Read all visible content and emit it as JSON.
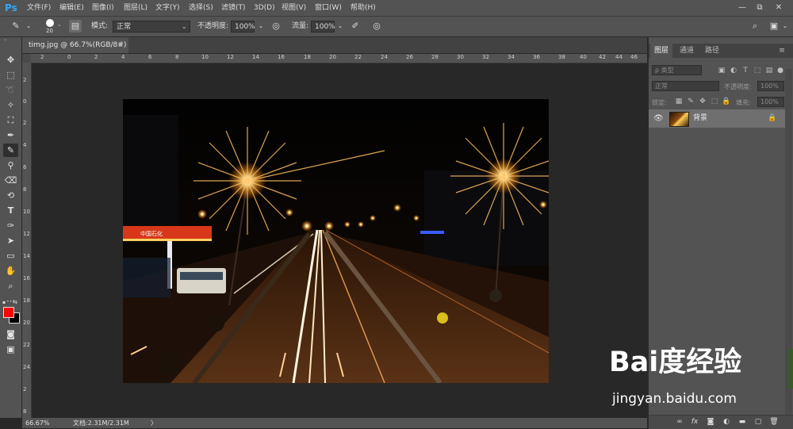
{
  "app": {
    "logo": "Ps"
  },
  "menu": [
    "文件(F)",
    "编辑(E)",
    "图像(I)",
    "图层(L)",
    "文字(Y)",
    "选择(S)",
    "滤镜(T)",
    "3D(D)",
    "视图(V)",
    "窗口(W)",
    "帮助(H)"
  ],
  "window_controls": {
    "minimize": "—",
    "restore": "⧉",
    "close": "✕"
  },
  "options": {
    "brush_size": "20",
    "mode_label": "模式:",
    "mode_value": "正常",
    "opacity_label": "不透明度:",
    "opacity_value": "100%",
    "flow_label": "流量:",
    "flow_value": "100%"
  },
  "document": {
    "tab_title": "timg.jpg @ 66.7%(RGB/8#)",
    "tab_close": "×",
    "ruler_top": [
      "2",
      "0",
      "2",
      "4",
      "6",
      "8",
      "10",
      "12",
      "14",
      "16",
      "18",
      "20",
      "22",
      "24",
      "26",
      "28",
      "30",
      "32",
      "34",
      "36",
      "38",
      "40",
      "42",
      "44",
      "46"
    ],
    "ruler_left": [
      "2",
      "0",
      "2",
      "4",
      "6",
      "8",
      "10",
      "12",
      "14",
      "16",
      "18",
      "20",
      "22",
      "24",
      "2",
      "8"
    ]
  },
  "status": {
    "zoom": "66.67%",
    "doc_size": "文档:2.31M/2.31M",
    "arrow": "〉"
  },
  "layers_panel": {
    "tabs": [
      "图层",
      "通道",
      "路径"
    ],
    "filter_placeholder": "ρ 类型",
    "blend_mode": "正常",
    "opacity_label": "不透明度:",
    "opacity_value": "100%",
    "lock_label": "锁定:",
    "fill_label": "填充:",
    "fill_value": "100%",
    "layer_name": "背景"
  },
  "watermark": {
    "logo": "Bai度经验",
    "url": "jingyan.baidu.com"
  },
  "colors": {
    "foreground": "#ff0000",
    "background": "#000000",
    "ps_blue": "#31a8ff",
    "ui_panel": "#535353",
    "canvas_bg": "#282828"
  },
  "tools": [
    "move-tool",
    "marquee-tool",
    "lasso-tool",
    "quick-select-tool",
    "crop-tool",
    "eyedropper-tool",
    "brush-tool",
    "stamp-tool",
    "eraser-tool",
    "history-brush-tool",
    "text-tool",
    "pen-tool",
    "path-select-tool",
    "shape-tool",
    "hand-tool",
    "zoom-tool",
    "more-tools"
  ]
}
